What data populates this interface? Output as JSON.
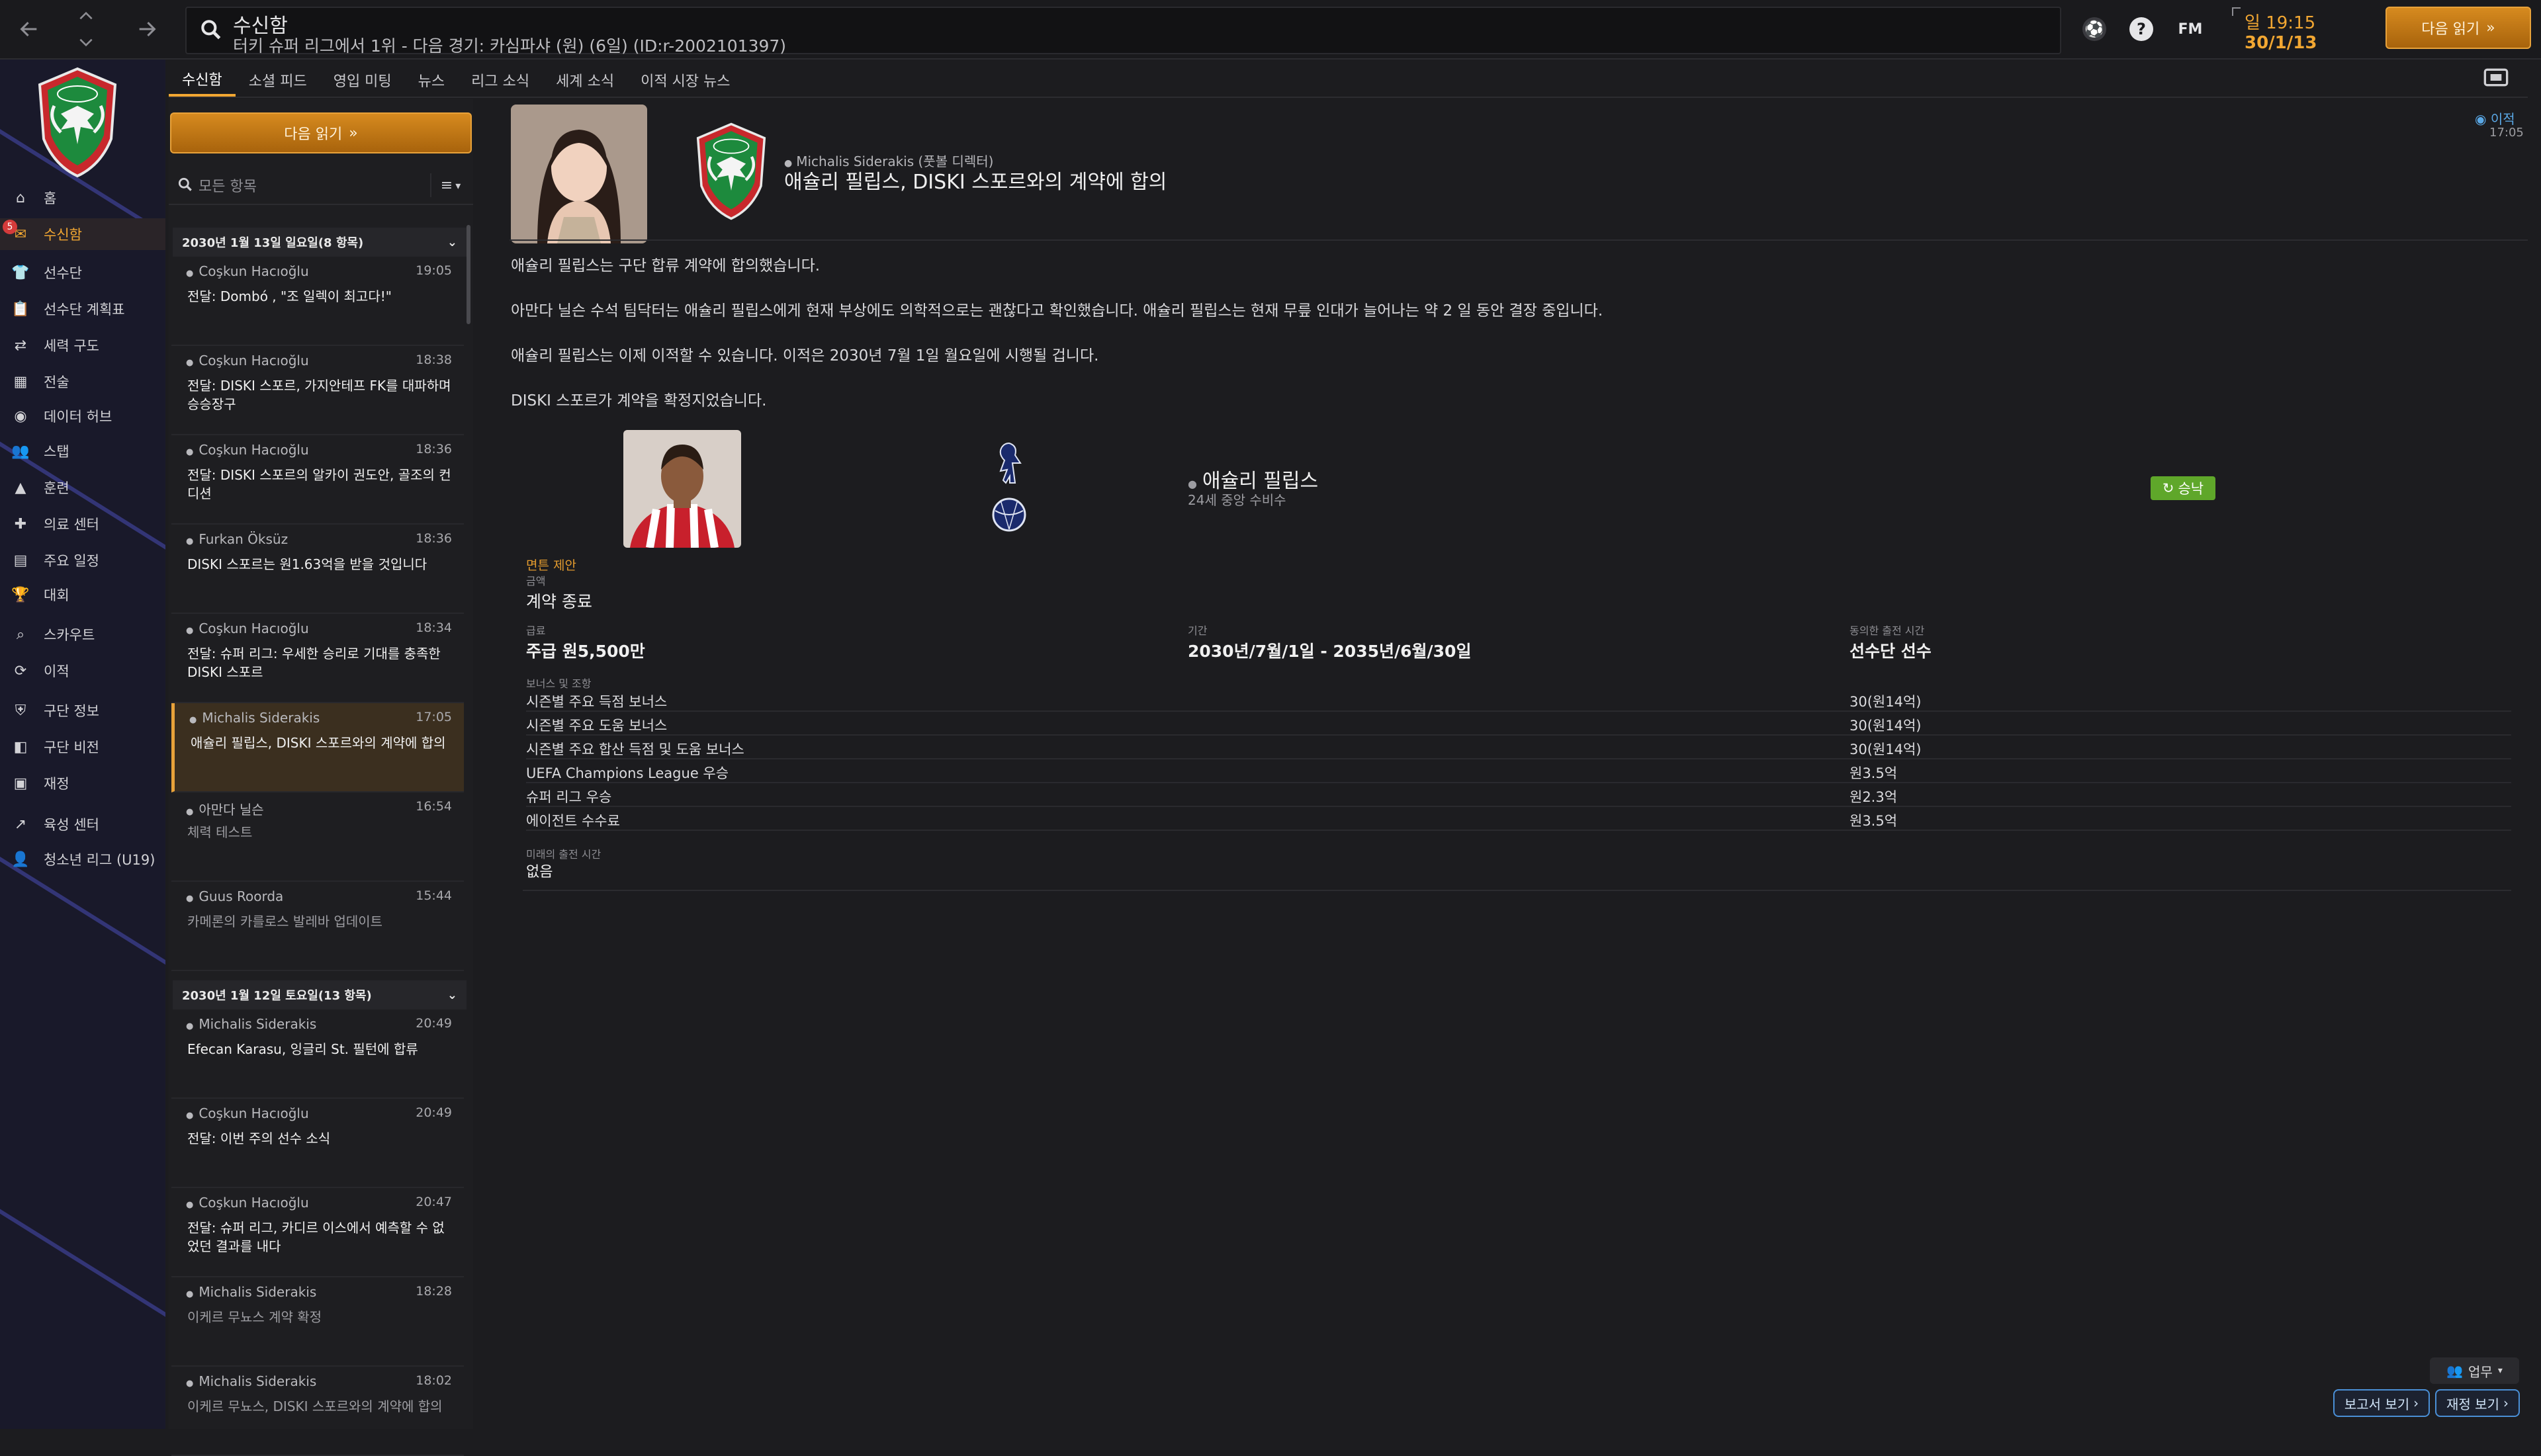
{
  "header": {
    "title": "수신함",
    "subtitle": "터키 슈퍼 리그에서 1위 - 다음 경기: 카심파샤 (원) (6일) (ID:r-2002101397)",
    "fm_label": "FM",
    "time": "일 19:15",
    "date": "30/1/13",
    "continue_label": "다음 읽기"
  },
  "sidebar": {
    "badge_count": "5",
    "items": [
      {
        "label": "홈",
        "icon": "home-icon"
      },
      {
        "label": "수신함",
        "icon": "inbox-icon"
      },
      {
        "label": "선수단",
        "icon": "shirt-icon"
      },
      {
        "label": "선수단 계획표",
        "icon": "clipboard-icon"
      },
      {
        "label": "세력 구도",
        "icon": "dynamics-icon"
      },
      {
        "label": "전술",
        "icon": "tactics-icon"
      },
      {
        "label": "데이터 허브",
        "icon": "data-hub-icon"
      },
      {
        "label": "스탭",
        "icon": "staff-icon"
      },
      {
        "label": "훈련",
        "icon": "training-icon"
      },
      {
        "label": "의료 센터",
        "icon": "medical-icon"
      },
      {
        "label": "주요 일정",
        "icon": "calendar-icon"
      },
      {
        "label": "대회",
        "icon": "trophy-icon"
      },
      {
        "label": "스카우트",
        "icon": "scout-icon"
      },
      {
        "label": "이적",
        "icon": "transfer-icon"
      },
      {
        "label": "구단 정보",
        "icon": "club-info-icon"
      },
      {
        "label": "구단 비전",
        "icon": "vision-icon"
      },
      {
        "label": "재정",
        "icon": "finance-icon"
      },
      {
        "label": "육성 센터",
        "icon": "development-icon"
      },
      {
        "label": "청소년 리그 (U19)",
        "icon": "youth-icon"
      }
    ]
  },
  "tabs": [
    "수신함",
    "소셜 피드",
    "영입 미팅",
    "뉴스",
    "리그 소식",
    "세계 소식",
    "이적 시장 뉴스"
  ],
  "inbox": {
    "continue_label": "다음 읽기",
    "filter_placeholder": "모든 항목",
    "groups": [
      {
        "label": "2030년 1월 13일 일요일(8 항목)"
      },
      {
        "label": "2030년 1월 12일 토요일(13 항목)"
      }
    ],
    "messages": [
      {
        "sender": "Coşkun Hacıoğlu",
        "time": "19:05",
        "subject": "전달: Dombó , \"조 일렉이 최고다!\""
      },
      {
        "sender": "Coşkun Hacıoğlu",
        "time": "18:38",
        "subject": "전달: DISKI 스포르, 가지안테프 FK를 대파하며 승승장구"
      },
      {
        "sender": "Coşkun Hacıoğlu",
        "time": "18:36",
        "subject": "전달: DISKI 스포르의 알카이 권도안, 골조의 컨디션"
      },
      {
        "sender": "Furkan Öksüz",
        "time": "18:36",
        "subject": "DISKI 스포르는 원1.63억을 받을 것입니다"
      },
      {
        "sender": "Coşkun Hacıoğlu",
        "time": "18:34",
        "subject": "전달: 슈퍼 리그: 우세한 승리로 기대를 충족한 DISKI 스포르"
      },
      {
        "sender": "Michalis Siderakis",
        "time": "17:05",
        "subject": "애슐리 필립스, DISKI 스포르와의 계약에 합의"
      },
      {
        "sender": "아만다 닐슨",
        "time": "16:54",
        "subject": "체력 테스트"
      },
      {
        "sender": "Guus Roorda",
        "time": "15:44",
        "subject": "카메론의 카를로스 발레바 업데이트"
      },
      {
        "sender": "Michalis Siderakis",
        "time": "20:49",
        "subject": "Efecan Karasu, 잉글리 St. 필턴에 합류"
      },
      {
        "sender": "Coşkun Hacıoğlu",
        "time": "20:49",
        "subject": "전달: 이번 주의 선수 소식"
      },
      {
        "sender": "Coşkun Hacıoğlu",
        "time": "20:47",
        "subject": "전달: 슈퍼 리그, 카디르 이스에서 예측할 수 없었던 결과를 내다"
      },
      {
        "sender": "Michalis Siderakis",
        "time": "18:28",
        "subject": "이케르 무뇨스 계약 확정"
      },
      {
        "sender": "Michalis Siderakis",
        "time": "18:02",
        "subject": "이케르 무뇨스, DISKI 스포르와의 계약에 합의"
      }
    ]
  },
  "article": {
    "from": "Michalis Siderakis (풋볼 디렉터)",
    "title": "애슐리 필립스, DISKI 스포르와의 계약에 합의",
    "read_status": "이적",
    "time": "17:05",
    "paragraphs": [
      "애슐리 필립스는 구단 합류 계약에 합의했습니다.",
      "아만다 닐슨 수석 팀닥터는 애슐리 필립스에게 현재 부상에도 의학적으로는 괜찮다고 확인했습니다. 애슐리 필립스는 현재 무릎 인대가 늘어나는 약 2 일 동안 결장 중입니다.",
      "애슐리 필립스는 이제 이적할 수 있습니다. 이적은 2030년 7월 1일 월요일에 시행될 겁니다.",
      "DISKI 스포르가 계약을 확정지었습니다."
    ]
  },
  "contract": {
    "player_name": "애슐리 필립스",
    "player_desc": "24세 중앙 수비수",
    "status": "승낙",
    "release_label": "면튼 제안",
    "fee_head": "금액",
    "fee_value": "계약 종료",
    "wage_head": "급료",
    "wage_value": "주급 원5,500만",
    "period_head": "기간",
    "period_value": "2030년/7월/1일 - 2035년/6월/30일",
    "role_head": "동의한 출전 시간",
    "role_value": "선수단 선수",
    "bonus_head": "보너스 및 조항",
    "bonuses": [
      {
        "label": "시즌별 주요 득점 보너스",
        "value": "30(원14억)"
      },
      {
        "label": "시즌별 주요 도움 보너스",
        "value": "30(원14억)"
      },
      {
        "label": "시즌별 주요 합산 득점 및 도움 보너스",
        "value": "30(원14억)"
      },
      {
        "label": "UEFA Champions League 우승",
        "value": "원3.5억"
      },
      {
        "label": "슈퍼 리그 우승",
        "value": "원2.3억"
      },
      {
        "label": "에이전트 수수료",
        "value": "원3.5억"
      }
    ],
    "future_head": "미래의 출전 시간",
    "future_value": "없음"
  },
  "footer": {
    "work_label": "업무",
    "report_label": "보고서 보기",
    "finance_label": "재정 보기"
  },
  "colors": {
    "accent": "#f2a732",
    "background": "#1c1c1f",
    "sidebar": "#19192a",
    "accepted": "#5fa72a",
    "link": "#4a8fd6"
  }
}
